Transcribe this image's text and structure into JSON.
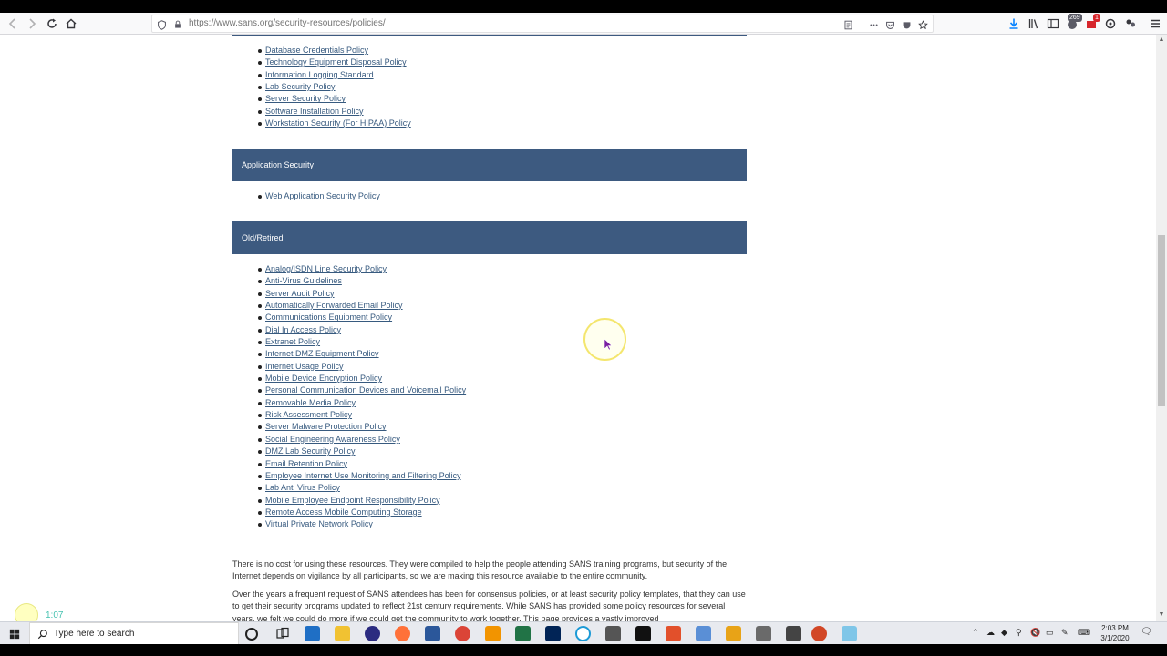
{
  "browser": {
    "url": "https://www.sans.org/security-resources/policies/",
    "badge_count": "269",
    "badge_small": "1"
  },
  "sections": {
    "continued_links": [
      "Database Credentials Policy",
      "Technology Equipment Disposal Policy",
      "Information Logging Standard",
      "Lab Security Policy",
      "Server Security Policy",
      "Software Installation Policy",
      "Workstation Security (For HIPAA) Policy"
    ],
    "application_security": {
      "title": "Application Security",
      "links": [
        "Web Application Security Policy"
      ]
    },
    "old_retired": {
      "title": "Old/Retired",
      "links": [
        "Analog/ISDN Line Security Policy",
        "Anti-Virus Guidelines",
        "Server Audit Policy",
        "Automatically Forwarded Email Policy",
        "Communications Equipment Policy",
        "Dial In Access Policy",
        "Extranet Policy",
        "Internet DMZ Equipment Policy",
        "Internet Usage Policy",
        "Mobile Device Encryption Policy",
        "Personal Communication Devices and Voicemail Policy",
        "Removable Media Policy",
        "Risk Assessment Policy",
        "Server Malware Protection Policy",
        "Social Engineering Awareness Policy",
        "DMZ Lab Security Policy",
        "Email Retention Policy",
        "Employee Internet Use Monitoring and Filtering Policy",
        "Lab Anti Virus Policy",
        "Mobile Employee Endpoint Responsibility Policy",
        "Remote Access Mobile Computing Storage",
        "Virtual Private Network Policy"
      ]
    }
  },
  "paragraphs": {
    "p1": "There is no cost for using these resources. They were compiled to help the people attending SANS training programs, but security of the Internet depends on vigilance by all participants, so we are making this resource available to the entire community.",
    "p2": "Over the years a frequent request of SANS attendees has been for consensus policies, or at least security policy templates, that they can use to get their security programs updated to reflect 21st century requirements. While SANS has provided some policy resources for several years, we felt we could do more if we could get the community to work together. This page provides a vastly improved"
  },
  "recorder": {
    "time": "1:07"
  },
  "taskbar": {
    "search_placeholder": "Type here to search",
    "time": "2:03 PM",
    "date": "3/1/2020"
  },
  "colors": {
    "section_header": "#3d5a80",
    "link": "#375a7f"
  }
}
